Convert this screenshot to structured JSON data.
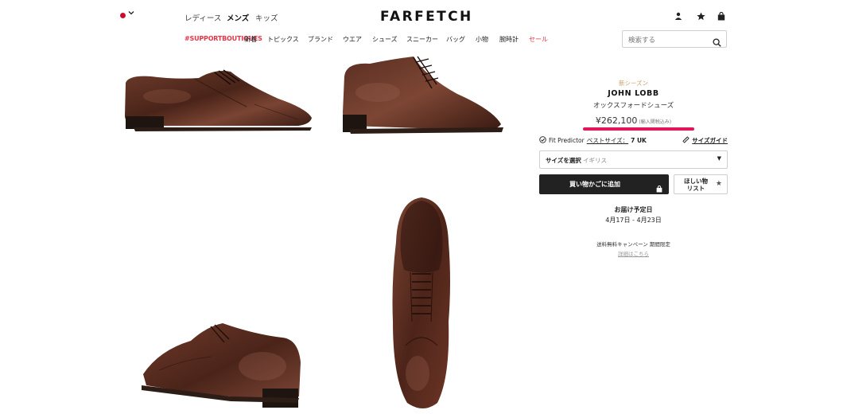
{
  "colors": {
    "accent_red": "#e8334a",
    "flag_red": "#c8102e",
    "season_gold": "#c9a06a",
    "underline_pink": "#e0185a",
    "button_dark": "#222222"
  },
  "header": {
    "country_flag_icon": "japan-flag-icon",
    "gender_tabs": [
      "レディース",
      "メンズ",
      "キッズ"
    ],
    "logo": "FARFETCH",
    "icons": [
      "account-icon",
      "wishlist-star-icon",
      "shopping-bag-icon"
    ]
  },
  "nav": {
    "items": [
      "#SUPPORTBOUTIQUES",
      "新着",
      "トピックス",
      "ブランド",
      "ウエア",
      "シューズ",
      "スニーカー",
      "バッグ",
      "小物",
      "腕時計",
      "セール"
    ]
  },
  "search": {
    "placeholder": "検索する"
  },
  "gallery": {
    "images": [
      "shoe-side-view",
      "shoe-three-quarter-view",
      "shoe-rear-view",
      "shoe-top-view"
    ]
  },
  "product": {
    "season": "新シーズン",
    "brand": "JOHN LOBB",
    "name": "オックスフォードシューズ",
    "price": "¥262,100",
    "tax_note": "(輸入関税込み)",
    "fit_predictor_label": "Fit Predictor",
    "best_size_label": "ベストサイズ：",
    "best_size_value": "7 UK",
    "size_guide": "サイズガイド",
    "size_select_label": "サイズを選択",
    "size_country": "イギリス",
    "add_to_bag": "買い物かごに追加",
    "wishlist_line1": "ほしい物",
    "wishlist_line2": "リスト",
    "delivery_title": "お届け予定日",
    "delivery_date": "4月17日 - 4月23日",
    "promo_text": "送料無料キャンペーン 期間限定",
    "promo_link": "詳細はこちら"
  }
}
